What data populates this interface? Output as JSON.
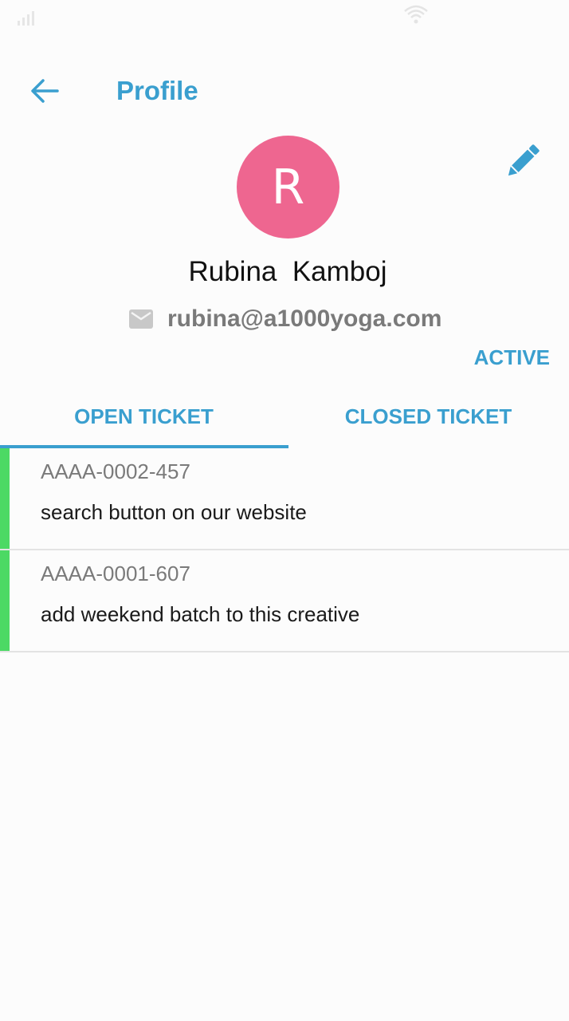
{
  "app": {
    "accent_color": "#3a9fcf",
    "avatar_color": "#ee6690",
    "ticket_bar_color": "#4cd964"
  },
  "header": {
    "title": "Profile",
    "back_icon": "arrow-left-icon",
    "edit_icon": "pencil-icon"
  },
  "profile": {
    "avatar_initial": "R",
    "name": "Rubina  Kamboj",
    "email": "rubina@a1000yoga.com",
    "email_icon": "mail-icon",
    "status": "ACTIVE"
  },
  "tabs": [
    {
      "label": "OPEN TICKET",
      "selected": true
    },
    {
      "label": "CLOSED TICKET",
      "selected": false
    }
  ],
  "tickets": [
    {
      "id": "AAAA-0002-457",
      "subject": "search button on our website"
    },
    {
      "id": "AAAA-0001-607",
      "subject": "add weekend batch to this creative"
    }
  ]
}
